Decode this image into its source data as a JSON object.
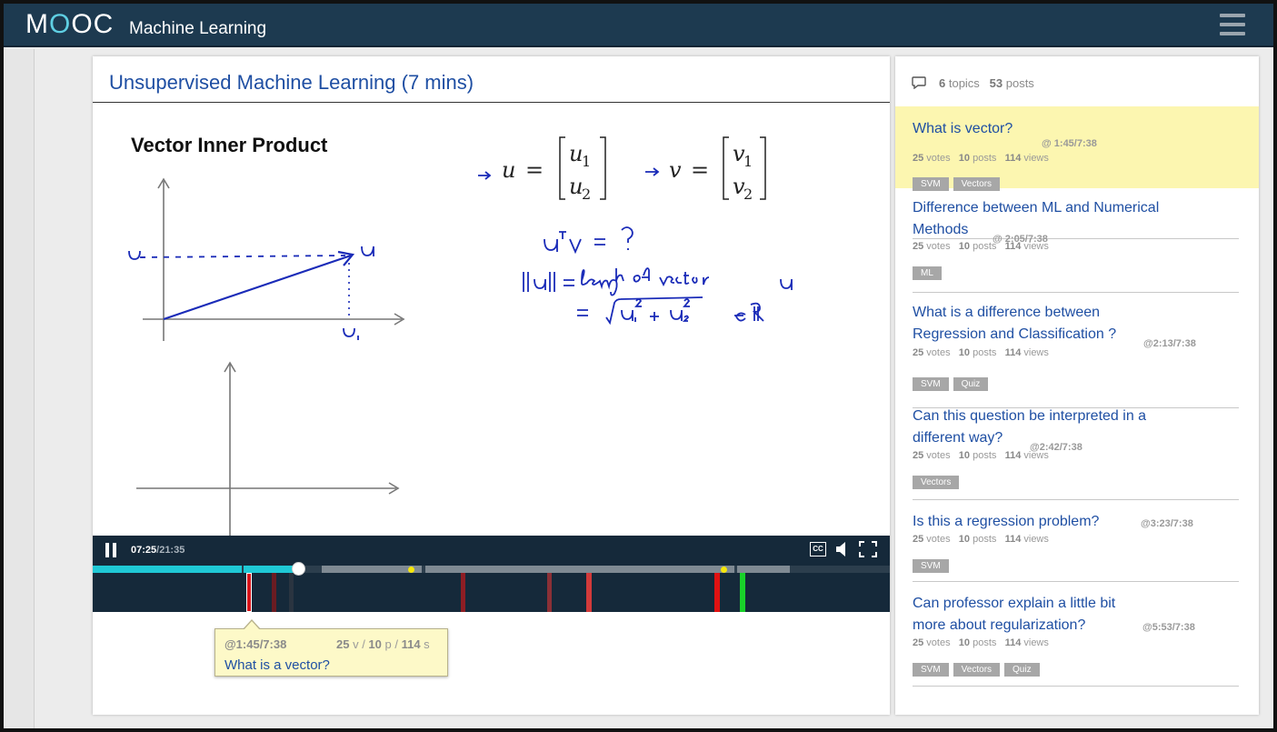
{
  "app": {
    "logo": "MOOC",
    "logo_left": "M",
    "logo_o": "O",
    "logo_right": "OC",
    "course": "Machine Learning"
  },
  "video": {
    "title": "Unsupervised Machine Learning (7 mins)",
    "slide_title": "Vector Inner Product",
    "time_current": "07:25",
    "time_total": "/21:35",
    "cc_label": "CC",
    "progress_fraction": 0.344
  },
  "caption": {
    "time": "@1:45/7:38",
    "votes": "25",
    "v": " v / ",
    "posts": "10",
    "p": " p / ",
    "views": "114",
    "s": " s",
    "title": "What is a vector?"
  },
  "sidebar": {
    "topics_count": "6",
    "topics_label": " topics",
    "posts_count": "53",
    "posts_label": " posts",
    "labels": {
      "votes": " votes",
      "posts": " posts",
      "views": " views"
    },
    "items": [
      {
        "line1": "What is vector?",
        "line2": "",
        "time": "@ 1:45/7:38",
        "votes": "25",
        "posts": "10",
        "views": "114",
        "tags": [
          "SVM",
          "Vectors"
        ]
      },
      {
        "line1": "Difference between ML and Numerical",
        "line2": "Methods",
        "time": "@ 2:05/7:38",
        "votes": "25",
        "posts": "10",
        "views": "114",
        "tags": [
          "ML"
        ]
      },
      {
        "line1": "What is a difference between",
        "line2": "Regression and Classification ?",
        "time": "@2:13/7:38",
        "votes": "25",
        "posts": "10",
        "views": "114",
        "tags": [
          "SVM",
          "Quiz"
        ]
      },
      {
        "line1": "Can this question be interpreted in a",
        "line2": "different way?",
        "time": "@2:42/7:38",
        "votes": "25",
        "posts": "10",
        "views": "114",
        "tags": [
          "Vectors"
        ]
      },
      {
        "line1": "Is this a regression problem?",
        "line2": "",
        "time": "@3:23/7:38",
        "votes": "25",
        "posts": "10",
        "views": "114",
        "tags": [
          "SVM"
        ]
      },
      {
        "line1": "Can professor explain a little bit",
        "line2": "more about regularization?",
        "time": "@5:53/7:38",
        "votes": "25",
        "posts": "10",
        "views": "114",
        "tags": [
          "SVM",
          "Vectors",
          "Quiz"
        ]
      }
    ]
  },
  "colors": {
    "header": "#1d3a50",
    "link": "#1f4fa3",
    "highlight": "#fcf6b0",
    "progress": "#1fc9d6"
  }
}
